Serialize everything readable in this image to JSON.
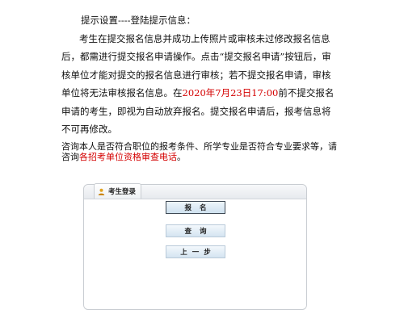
{
  "notice": {
    "title": "提示设置----登陆提示信息：",
    "paragraph_1": {
      "text_a": "考生在提交报名信息并成功上传照片或审核未过修改报名信息后，都需进行提交报名申请操作。点击“提交报名申请”按钮后，审核单位才能对提交的报名信息进行审核；若不提交报名申请，审核单位将无法审核报名信息。在",
      "deadline": "2020年7月23日17:00",
      "text_b": "前不提交报名申请的考生，即视为自动放弃报名。提交报名申请后，报考信息将不可再修改。"
    },
    "consult_text": "咨询本人是否符合职位的报考条件、所学专业是否符合专业要求等，请咨询",
    "consult_highlight": "各招考单位资格审查电话",
    "consult_end": "。"
  },
  "login_panel": {
    "tab_label": "考生登录",
    "tab_icon": "user-icon",
    "buttons": {
      "register": "报名",
      "query": "查询",
      "back": "上一步"
    }
  },
  "colors": {
    "highlight": "#d40000",
    "button_gradient_top": "#f3f8fc",
    "button_gradient_bottom": "#d4e4f1"
  }
}
